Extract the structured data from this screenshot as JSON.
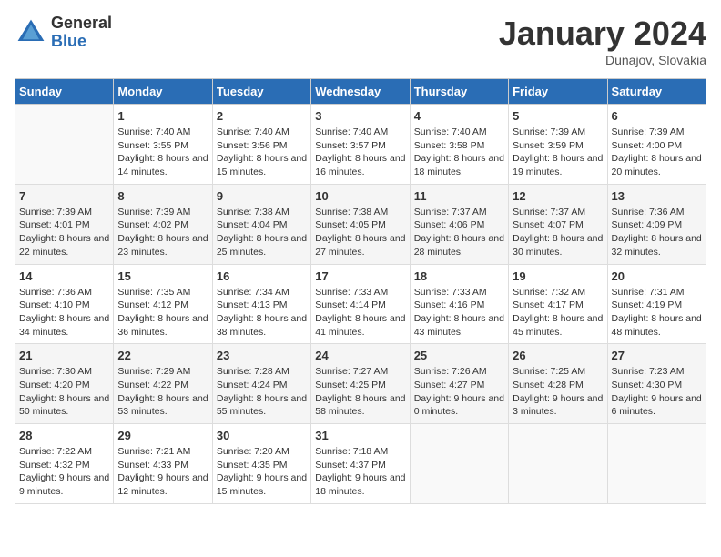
{
  "header": {
    "logo_general": "General",
    "logo_blue": "Blue",
    "month_title": "January 2024",
    "location": "Dunajov, Slovakia"
  },
  "days_of_week": [
    "Sunday",
    "Monday",
    "Tuesday",
    "Wednesday",
    "Thursday",
    "Friday",
    "Saturday"
  ],
  "weeks": [
    [
      {
        "day": "",
        "sunrise": "",
        "sunset": "",
        "daylight": "",
        "empty": true
      },
      {
        "day": "1",
        "sunrise": "Sunrise: 7:40 AM",
        "sunset": "Sunset: 3:55 PM",
        "daylight": "Daylight: 8 hours and 14 minutes."
      },
      {
        "day": "2",
        "sunrise": "Sunrise: 7:40 AM",
        "sunset": "Sunset: 3:56 PM",
        "daylight": "Daylight: 8 hours and 15 minutes."
      },
      {
        "day": "3",
        "sunrise": "Sunrise: 7:40 AM",
        "sunset": "Sunset: 3:57 PM",
        "daylight": "Daylight: 8 hours and 16 minutes."
      },
      {
        "day": "4",
        "sunrise": "Sunrise: 7:40 AM",
        "sunset": "Sunset: 3:58 PM",
        "daylight": "Daylight: 8 hours and 18 minutes."
      },
      {
        "day": "5",
        "sunrise": "Sunrise: 7:39 AM",
        "sunset": "Sunset: 3:59 PM",
        "daylight": "Daylight: 8 hours and 19 minutes."
      },
      {
        "day": "6",
        "sunrise": "Sunrise: 7:39 AM",
        "sunset": "Sunset: 4:00 PM",
        "daylight": "Daylight: 8 hours and 20 minutes."
      }
    ],
    [
      {
        "day": "7",
        "sunrise": "Sunrise: 7:39 AM",
        "sunset": "Sunset: 4:01 PM",
        "daylight": "Daylight: 8 hours and 22 minutes."
      },
      {
        "day": "8",
        "sunrise": "Sunrise: 7:39 AM",
        "sunset": "Sunset: 4:02 PM",
        "daylight": "Daylight: 8 hours and 23 minutes."
      },
      {
        "day": "9",
        "sunrise": "Sunrise: 7:38 AM",
        "sunset": "Sunset: 4:04 PM",
        "daylight": "Daylight: 8 hours and 25 minutes."
      },
      {
        "day": "10",
        "sunrise": "Sunrise: 7:38 AM",
        "sunset": "Sunset: 4:05 PM",
        "daylight": "Daylight: 8 hours and 27 minutes."
      },
      {
        "day": "11",
        "sunrise": "Sunrise: 7:37 AM",
        "sunset": "Sunset: 4:06 PM",
        "daylight": "Daylight: 8 hours and 28 minutes."
      },
      {
        "day": "12",
        "sunrise": "Sunrise: 7:37 AM",
        "sunset": "Sunset: 4:07 PM",
        "daylight": "Daylight: 8 hours and 30 minutes."
      },
      {
        "day": "13",
        "sunrise": "Sunrise: 7:36 AM",
        "sunset": "Sunset: 4:09 PM",
        "daylight": "Daylight: 8 hours and 32 minutes."
      }
    ],
    [
      {
        "day": "14",
        "sunrise": "Sunrise: 7:36 AM",
        "sunset": "Sunset: 4:10 PM",
        "daylight": "Daylight: 8 hours and 34 minutes."
      },
      {
        "day": "15",
        "sunrise": "Sunrise: 7:35 AM",
        "sunset": "Sunset: 4:12 PM",
        "daylight": "Daylight: 8 hours and 36 minutes."
      },
      {
        "day": "16",
        "sunrise": "Sunrise: 7:34 AM",
        "sunset": "Sunset: 4:13 PM",
        "daylight": "Daylight: 8 hours and 38 minutes."
      },
      {
        "day": "17",
        "sunrise": "Sunrise: 7:33 AM",
        "sunset": "Sunset: 4:14 PM",
        "daylight": "Daylight: 8 hours and 41 minutes."
      },
      {
        "day": "18",
        "sunrise": "Sunrise: 7:33 AM",
        "sunset": "Sunset: 4:16 PM",
        "daylight": "Daylight: 8 hours and 43 minutes."
      },
      {
        "day": "19",
        "sunrise": "Sunrise: 7:32 AM",
        "sunset": "Sunset: 4:17 PM",
        "daylight": "Daylight: 8 hours and 45 minutes."
      },
      {
        "day": "20",
        "sunrise": "Sunrise: 7:31 AM",
        "sunset": "Sunset: 4:19 PM",
        "daylight": "Daylight: 8 hours and 48 minutes."
      }
    ],
    [
      {
        "day": "21",
        "sunrise": "Sunrise: 7:30 AM",
        "sunset": "Sunset: 4:20 PM",
        "daylight": "Daylight: 8 hours and 50 minutes."
      },
      {
        "day": "22",
        "sunrise": "Sunrise: 7:29 AM",
        "sunset": "Sunset: 4:22 PM",
        "daylight": "Daylight: 8 hours and 53 minutes."
      },
      {
        "day": "23",
        "sunrise": "Sunrise: 7:28 AM",
        "sunset": "Sunset: 4:24 PM",
        "daylight": "Daylight: 8 hours and 55 minutes."
      },
      {
        "day": "24",
        "sunrise": "Sunrise: 7:27 AM",
        "sunset": "Sunset: 4:25 PM",
        "daylight": "Daylight: 8 hours and 58 minutes."
      },
      {
        "day": "25",
        "sunrise": "Sunrise: 7:26 AM",
        "sunset": "Sunset: 4:27 PM",
        "daylight": "Daylight: 9 hours and 0 minutes."
      },
      {
        "day": "26",
        "sunrise": "Sunrise: 7:25 AM",
        "sunset": "Sunset: 4:28 PM",
        "daylight": "Daylight: 9 hours and 3 minutes."
      },
      {
        "day": "27",
        "sunrise": "Sunrise: 7:23 AM",
        "sunset": "Sunset: 4:30 PM",
        "daylight": "Daylight: 9 hours and 6 minutes."
      }
    ],
    [
      {
        "day": "28",
        "sunrise": "Sunrise: 7:22 AM",
        "sunset": "Sunset: 4:32 PM",
        "daylight": "Daylight: 9 hours and 9 minutes."
      },
      {
        "day": "29",
        "sunrise": "Sunrise: 7:21 AM",
        "sunset": "Sunset: 4:33 PM",
        "daylight": "Daylight: 9 hours and 12 minutes."
      },
      {
        "day": "30",
        "sunrise": "Sunrise: 7:20 AM",
        "sunset": "Sunset: 4:35 PM",
        "daylight": "Daylight: 9 hours and 15 minutes."
      },
      {
        "day": "31",
        "sunrise": "Sunrise: 7:18 AM",
        "sunset": "Sunset: 4:37 PM",
        "daylight": "Daylight: 9 hours and 18 minutes."
      },
      {
        "day": "",
        "empty": true
      },
      {
        "day": "",
        "empty": true
      },
      {
        "day": "",
        "empty": true
      }
    ]
  ]
}
